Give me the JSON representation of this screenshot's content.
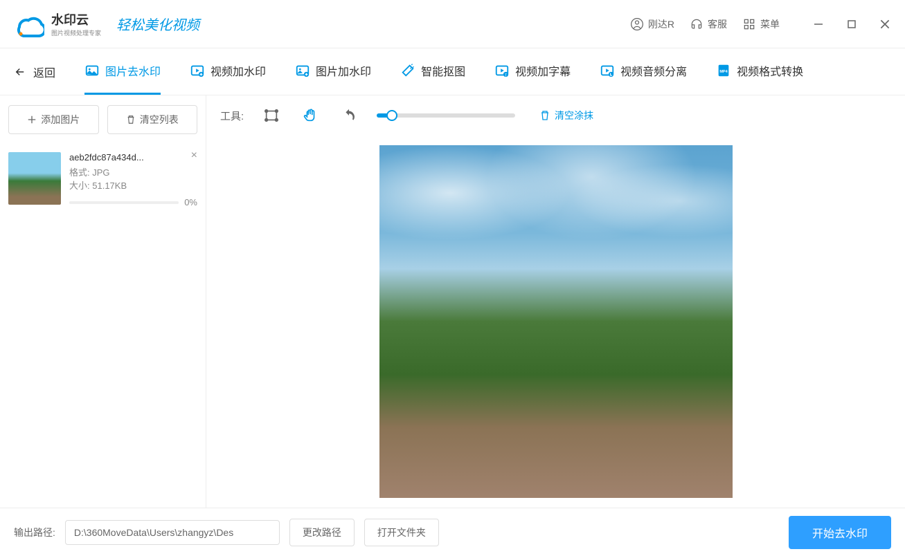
{
  "header": {
    "logo_title": "水印云",
    "logo_sub": "图片视频处理专家",
    "slogan": "轻松美化视频",
    "user": "刚达R",
    "support": "客服",
    "menu": "菜单"
  },
  "nav": {
    "back": "返回",
    "items": [
      {
        "label": "图片去水印",
        "active": true
      },
      {
        "label": "视频加水印",
        "active": false
      },
      {
        "label": "图片加水印",
        "active": false
      },
      {
        "label": "智能抠图",
        "active": false
      },
      {
        "label": "视频加字幕",
        "active": false
      },
      {
        "label": "视频音频分离",
        "active": false
      },
      {
        "label": "视频格式转换",
        "active": false
      }
    ]
  },
  "sidebar": {
    "add_btn": "添加图片",
    "clear_btn": "清空列表",
    "file": {
      "name": "aeb2fdc87a434d...",
      "format_label": "格式:",
      "format_value": "JPG",
      "size_label": "大小:",
      "size_value": "51.17KB",
      "progress": "0%"
    }
  },
  "toolbar": {
    "label": "工具:",
    "clear": "清空涂抹"
  },
  "footer": {
    "output_label": "输出路径:",
    "path": "D:\\360MoveData\\Users\\zhangyz\\Des",
    "change_path": "更改路径",
    "open_folder": "打开文件夹",
    "start": "开始去水印"
  }
}
